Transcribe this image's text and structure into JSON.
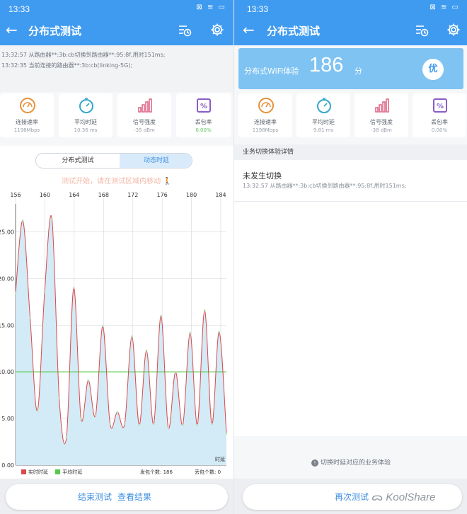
{
  "status_time": "13:33",
  "status_icons": "⊠ ≋ ▭",
  "title": "分布式测试",
  "left": {
    "logs": [
      "13:32:57 从路由器**:3b:cb切换到路由器**:95:8f,用时151ms;",
      "13:32:35 当前连接的路由器**:3b:cb(linking-5G);"
    ],
    "cards": [
      {
        "label": "连接速率",
        "value": "1198Mbps"
      },
      {
        "label": "平均时延",
        "value": "10.36 ms"
      },
      {
        "label": "信号强度",
        "value": "-35 dBm"
      },
      {
        "label": "丢包率",
        "value": "0.00%"
      }
    ],
    "tabs": [
      "分布式测试",
      "动态时延"
    ],
    "hint": "测试开始，请在测试区域内移动",
    "bottom": {
      "end_label": "结束测试",
      "view_label": "查看结果"
    }
  },
  "chart_data": {
    "type": "line",
    "xlabel": "时延",
    "x_ticks": [
      "156",
      "160",
      "164",
      "168",
      "172",
      "176",
      "180",
      "184"
    ],
    "y_ticks": [
      "0.00",
      "5.00",
      "10.00",
      "15.00",
      "20.00",
      "25.00"
    ],
    "ylim": [
      0,
      28
    ],
    "series": [
      {
        "name": "实时时延",
        "color": "#d94a4a",
        "values": [
          18.5,
          26.2,
          15.8,
          5.8,
          18.6,
          26.4,
          7.2,
          3.0,
          19.0,
          5.0,
          9.1,
          5.3,
          14.9,
          4.4,
          5.7,
          4.4,
          13.8,
          4.3,
          12.3,
          4.4,
          16.0,
          4.0,
          10.0,
          4.3,
          14.2,
          4.3,
          16.6,
          4.4,
          14.3,
          3.4
        ]
      },
      {
        "name": "平均时延",
        "color": "#56c94b",
        "values": [
          10.0,
          10.0
        ]
      }
    ],
    "legend": {
      "realtime": "实时时延",
      "average": "平均时延"
    },
    "packets_sent": "发包个数: 186",
    "packets_lost": "丢包个数: 0"
  },
  "right": {
    "wifi_label": "分布式WiFi体验",
    "score": "186",
    "score_unit": "分",
    "grade": "优",
    "cards": [
      {
        "label": "连接速率",
        "value": "1198Mbps"
      },
      {
        "label": "平均时延",
        "value": "9.81 ms"
      },
      {
        "label": "信号强度",
        "value": "-38 dBm"
      },
      {
        "label": "丢包率",
        "value": "0.00%"
      }
    ],
    "detail_title": "业务切换体验详情",
    "event_title": "未发生切换",
    "event_detail": "13:32:57 从路由器**:3b:cb切换到路由器**:95:8f,用时151ms;",
    "info": "切换时延对应的业务体验",
    "retest_label": "再次测试",
    "watermark": "KoolShare"
  },
  "colors": {
    "header": "#3f9bf0",
    "accent": "#3f8fe0",
    "fill": "#d3eaf7",
    "realtime": "#d94a4a",
    "average": "#56c94b",
    "orange": "#e8913a",
    "teal": "#34a7c9",
    "pink": "#e06b8b",
    "purple": "#8a5cc7"
  },
  "icons": [
    "back-arrow-icon",
    "list-clock-icon",
    "gear-icon",
    "gauge-icon",
    "timer-icon",
    "signal-bars-icon",
    "percent-icon",
    "info-icon",
    "wechat-icon"
  ]
}
